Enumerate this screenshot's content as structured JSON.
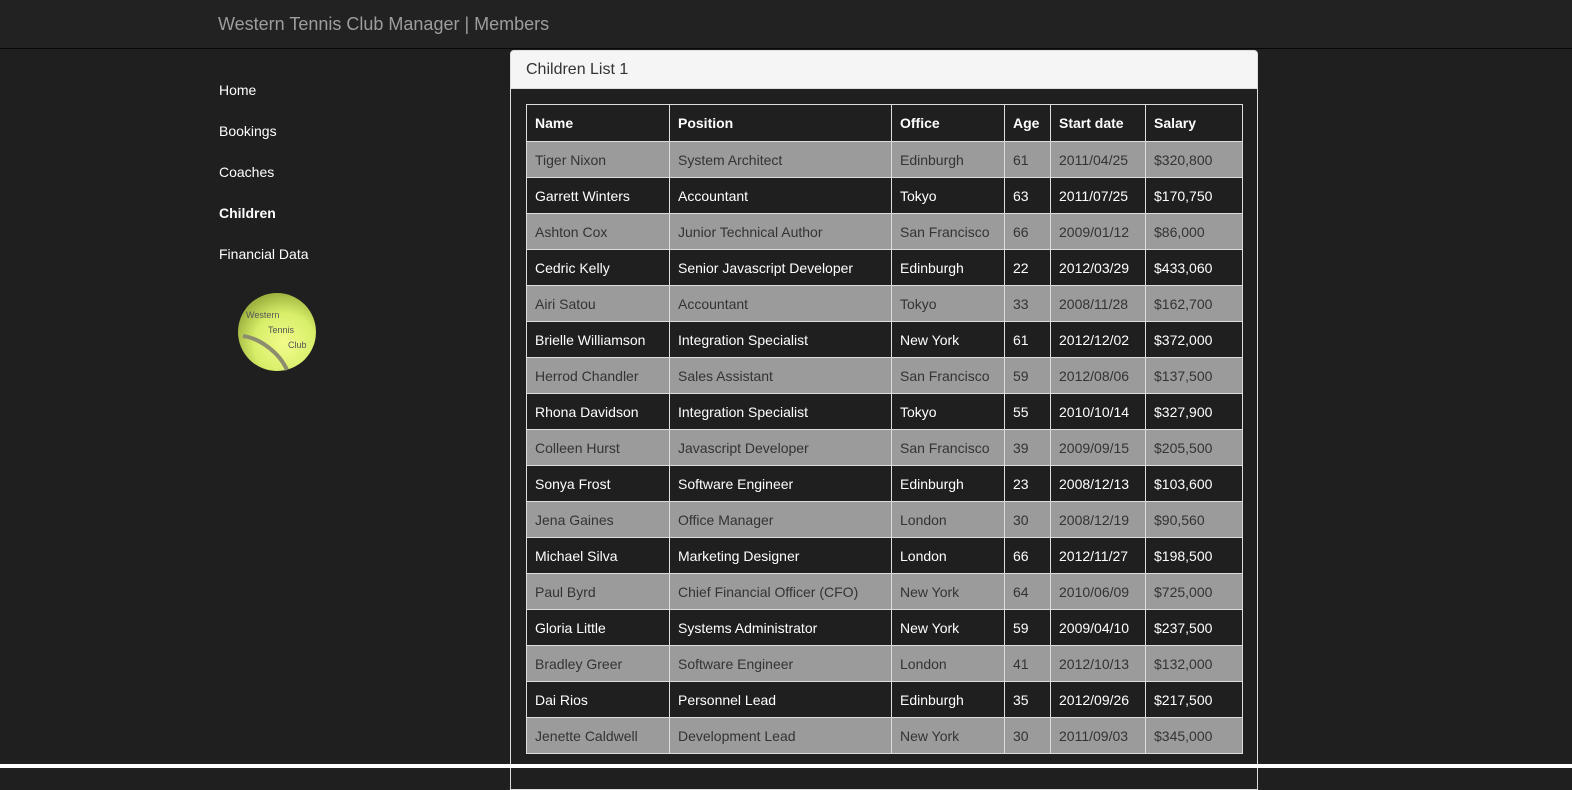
{
  "header": {
    "brand": "Western Tennis Club Manager | Members"
  },
  "sidebar": {
    "items": [
      {
        "label": "Home",
        "active": false
      },
      {
        "label": "Bookings",
        "active": false
      },
      {
        "label": "Coaches",
        "active": false
      },
      {
        "label": "Children",
        "active": true
      },
      {
        "label": "Financial Data",
        "active": false
      }
    ],
    "logo": {
      "icon": "tennis-ball-logo",
      "line1": "Western",
      "line2": "Tennis",
      "line3": "Club",
      "color": "#d8ef6a"
    }
  },
  "panel": {
    "title": "Children List 1",
    "columns": [
      "Name",
      "Position",
      "Office",
      "Age",
      "Start date",
      "Salary"
    ],
    "rows": [
      [
        "Tiger Nixon",
        "System Architect",
        "Edinburgh",
        "61",
        "2011/04/25",
        "$320,800"
      ],
      [
        "Garrett Winters",
        "Accountant",
        "Tokyo",
        "63",
        "2011/07/25",
        "$170,750"
      ],
      [
        "Ashton Cox",
        "Junior Technical Author",
        "San Francisco",
        "66",
        "2009/01/12",
        "$86,000"
      ],
      [
        "Cedric Kelly",
        "Senior Javascript Developer",
        "Edinburgh",
        "22",
        "2012/03/29",
        "$433,060"
      ],
      [
        "Airi Satou",
        "Accountant",
        "Tokyo",
        "33",
        "2008/11/28",
        "$162,700"
      ],
      [
        "Brielle Williamson",
        "Integration Specialist",
        "New York",
        "61",
        "2012/12/02",
        "$372,000"
      ],
      [
        "Herrod Chandler",
        "Sales Assistant",
        "San Francisco",
        "59",
        "2012/08/06",
        "$137,500"
      ],
      [
        "Rhona Davidson",
        "Integration Specialist",
        "Tokyo",
        "55",
        "2010/10/14",
        "$327,900"
      ],
      [
        "Colleen Hurst",
        "Javascript Developer",
        "San Francisco",
        "39",
        "2009/09/15",
        "$205,500"
      ],
      [
        "Sonya Frost",
        "Software Engineer",
        "Edinburgh",
        "23",
        "2008/12/13",
        "$103,600"
      ],
      [
        "Jena Gaines",
        "Office Manager",
        "London",
        "30",
        "2008/12/19",
        "$90,560"
      ],
      [
        "Michael Silva",
        "Marketing Designer",
        "London",
        "66",
        "2012/11/27",
        "$198,500"
      ],
      [
        "Paul Byrd",
        "Chief Financial Officer (CFO)",
        "New York",
        "64",
        "2010/06/09",
        "$725,000"
      ],
      [
        "Gloria Little",
        "Systems Administrator",
        "New York",
        "59",
        "2009/04/10",
        "$237,500"
      ],
      [
        "Bradley Greer",
        "Software Engineer",
        "London",
        "41",
        "2012/10/13",
        "$132,000"
      ],
      [
        "Dai Rios",
        "Personnel Lead",
        "Edinburgh",
        "35",
        "2012/09/26",
        "$217,500"
      ],
      [
        "Jenette Caldwell",
        "Development Lead",
        "New York",
        "30",
        "2011/09/03",
        "$345,000"
      ]
    ]
  },
  "colors": {
    "background": "#1f1f1f",
    "odd_row": "#9b9b9b",
    "even_row": "#1f1f1f",
    "brand_text": "#9d9d9d"
  }
}
